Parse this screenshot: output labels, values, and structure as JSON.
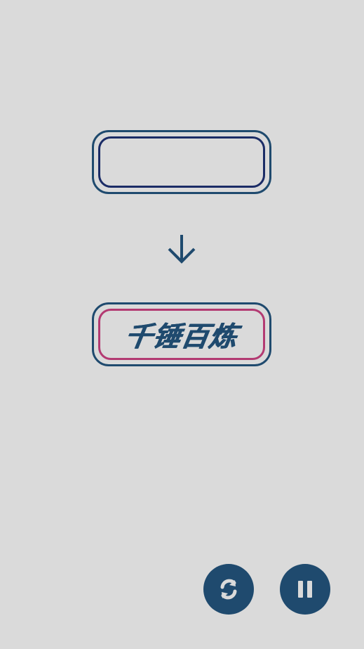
{
  "puzzle": {
    "input_value": "",
    "target_word": "千锤百炼"
  },
  "controls": {
    "refresh_icon": "refresh-icon",
    "pause_icon": "pause-icon"
  },
  "colors": {
    "background": "#dadada",
    "primary": "#1f4a6e",
    "input_inner_border": "#1b2c66",
    "target_inner_border": "#b33a72"
  }
}
